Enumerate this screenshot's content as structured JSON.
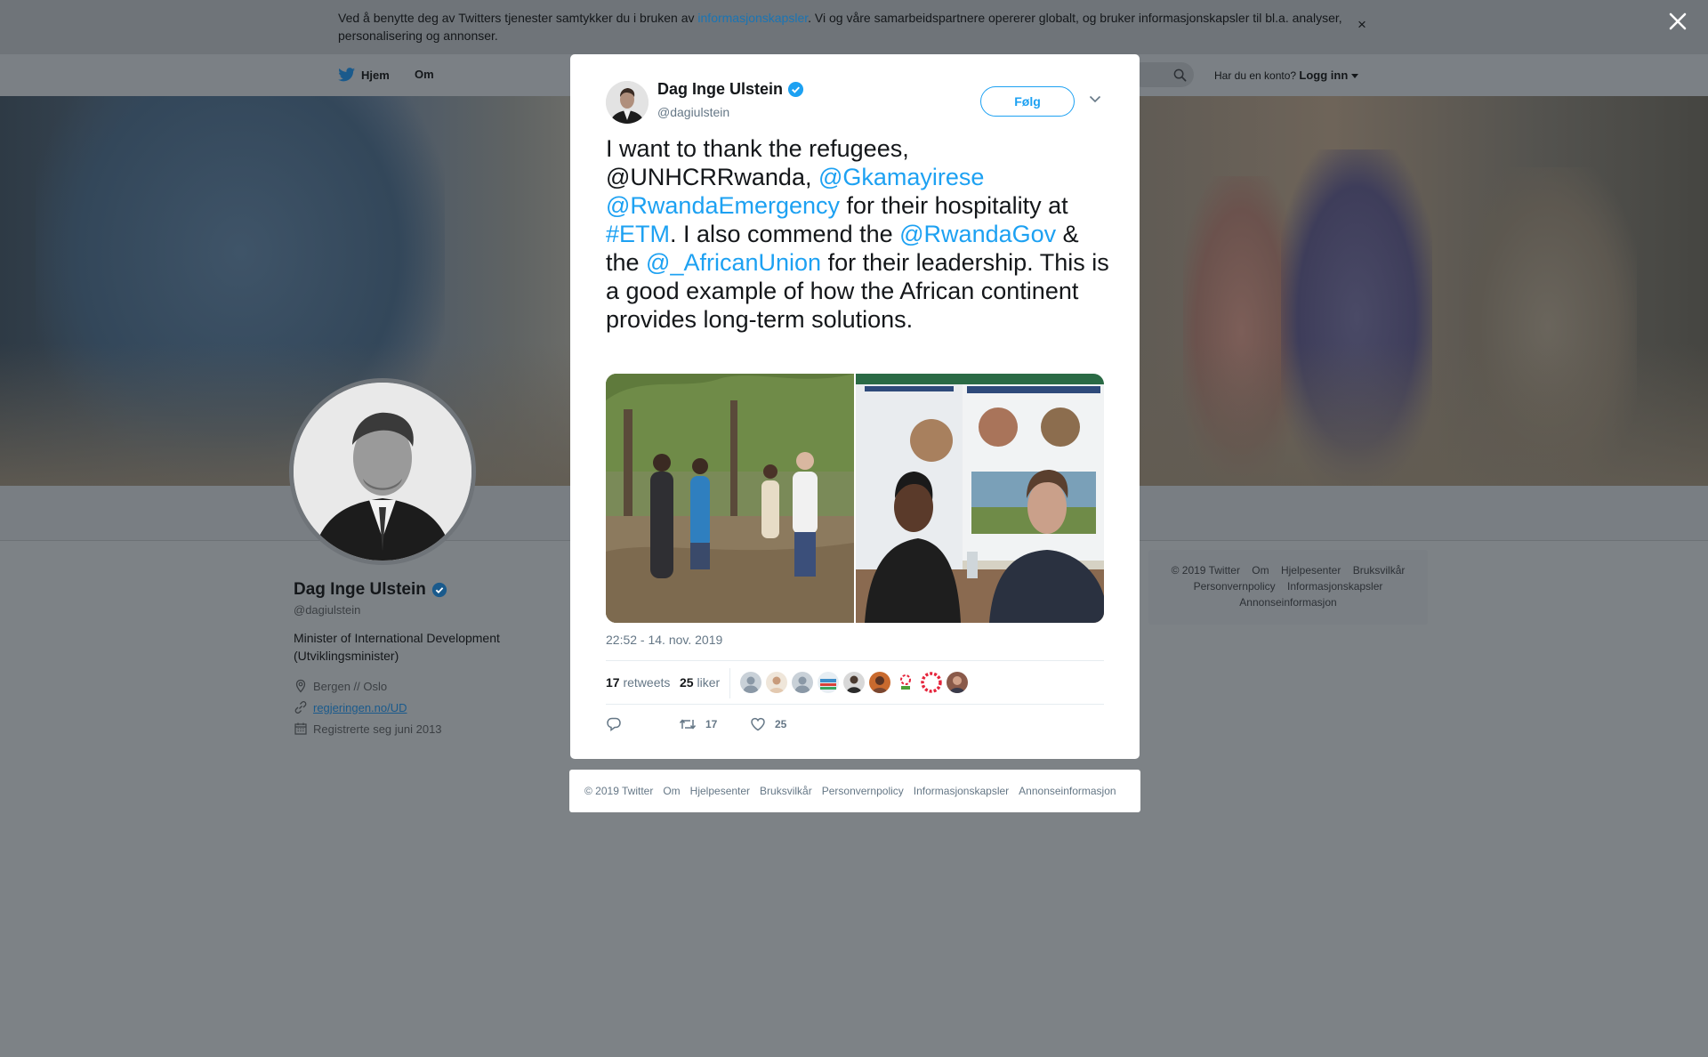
{
  "cookie_banner": {
    "text_before": "Ved å benytte deg av Twitters tjenester samtykker du i bruken av ",
    "link": "informasjonskapsler",
    "text_after": ". Vi og våre samarbeidspartnere opererer globalt, og bruker informasjonskapsler til bl.a. analyser, personalisering og annonser.",
    "close": "×"
  },
  "nav": {
    "home": "Hjem",
    "about": "Om",
    "have_account": "Har du en konto?",
    "login": "Logg inn"
  },
  "profile": {
    "name": "Dag Inge Ulstein",
    "handle": "@dagiulstein",
    "bio": "Minister of International Development (Utviklingsminister)",
    "location": "Bergen // Oslo",
    "website": "regjeringen.no/UD",
    "joined": "Registrerte seg juni 2013"
  },
  "side_footer": {
    "items": [
      "© 2019 Twitter",
      "Om",
      "Hjelpesenter",
      "Bruksvilkår",
      "Personvernpolicy",
      "Informasjonskapsler",
      "Annonseinformasjon"
    ]
  },
  "tweet": {
    "author_name": "Dag Inge Ulstein",
    "author_handle": "@dagiulstein",
    "follow": "Følg",
    "text": {
      "p1": "I want to thank the refugees,  @UNHCRRwanda, ",
      "m1": "@Gkamayirese",
      "m2": "@RwandaEmergency",
      "p2": " for their hospitality at ",
      "h1": "#ETM",
      "p3": ". I also commend the ",
      "m3": "@RwandaGov",
      "p4": " & the ",
      "m4": "@_AfricanUnion",
      "p5": " for their leadership. This is a good example of how the African continent provides long-term solutions."
    },
    "timestamp": "22:52 - 14. nov. 2019",
    "retweets_count": "17",
    "retweets_label": "retweets",
    "likes_count": "25",
    "likes_label": "liker",
    "action_retweets": "17",
    "action_likes": "25"
  },
  "modal_footer": {
    "items": [
      "© 2019 Twitter",
      "Om",
      "Hjelpesenter",
      "Bruksvilkår",
      "Personvernpolicy",
      "Informasjonskapsler",
      "Annonseinformasjon"
    ]
  },
  "colors": {
    "link_blue": "#1da1f2",
    "verified_blue": "#1da1f2",
    "overlay": "#7d8286"
  },
  "icons": [
    "twitter-bird-icon",
    "home-icon",
    "search-icon",
    "close-icon",
    "verified-badge-icon",
    "location-icon",
    "link-icon",
    "calendar-icon",
    "chevron-down-icon",
    "reply-icon",
    "retweet-icon",
    "heart-icon"
  ]
}
